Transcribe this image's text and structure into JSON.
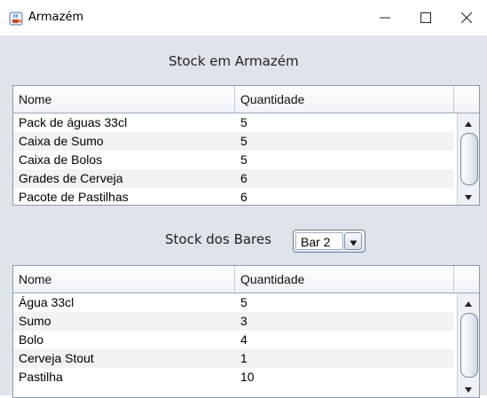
{
  "window": {
    "title": "Armazém",
    "app_icon": "java-cup-icon",
    "controls": [
      "minimize-icon",
      "maximize-icon",
      "close-icon"
    ]
  },
  "warehouse": {
    "title": "Stock em Armazém",
    "columns": [
      "Nome",
      "Quantidade"
    ],
    "rows": [
      {
        "name": "Pack de águas 33cl",
        "qty": "5"
      },
      {
        "name": "Caixa de Sumo",
        "qty": "5"
      },
      {
        "name": "Caixa de Bolos",
        "qty": "5"
      },
      {
        "name": "Grades de Cerveja",
        "qty": "6"
      },
      {
        "name": "Pacote de Pastilhas",
        "qty": "6"
      }
    ]
  },
  "bars": {
    "title": "Stock dos Bares",
    "selected_bar": "Bar 2",
    "columns": [
      "Nome",
      "Quantidade"
    ],
    "rows": [
      {
        "name": "Água 33cl",
        "qty": "5"
      },
      {
        "name": "Sumo",
        "qty": "3"
      },
      {
        "name": "Bolo",
        "qty": "4"
      },
      {
        "name": "Cerveja Stout",
        "qty": "1"
      },
      {
        "name": "Pastilha",
        "qty": "10"
      }
    ]
  },
  "colors": {
    "panel_bg": "#dfe3ea",
    "table_border": "#8a9bb0",
    "alt_row": "#f2f2f2"
  }
}
